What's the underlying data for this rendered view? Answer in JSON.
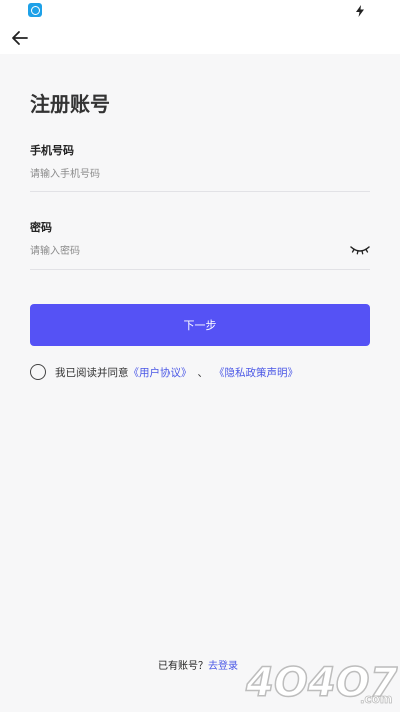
{
  "page": {
    "title": "注册账号"
  },
  "form": {
    "phone_label": "手机号码",
    "phone_placeholder": "请输入手机号码",
    "password_label": "密码",
    "password_placeholder": "请输入密码"
  },
  "actions": {
    "next_label": "下一步"
  },
  "agreement": {
    "prefix": "我已阅读并同意",
    "user_agreement": "《用户协议》",
    "separator": "、",
    "privacy_policy": "《隐私政策声明》"
  },
  "footer": {
    "has_account": "已有账号？",
    "login_link": "去登录"
  },
  "watermark": {
    "text": "4O4O7",
    "suffix": ".com"
  },
  "colors": {
    "accent": "#5552f5",
    "link": "#4a57e6",
    "background": "#f7f7f8"
  },
  "icons": {
    "back": "arrow-left-icon",
    "password_toggle": "eye-closed-icon",
    "status_app": "app-notification-icon",
    "status_charging": "charging-bolt-icon"
  }
}
